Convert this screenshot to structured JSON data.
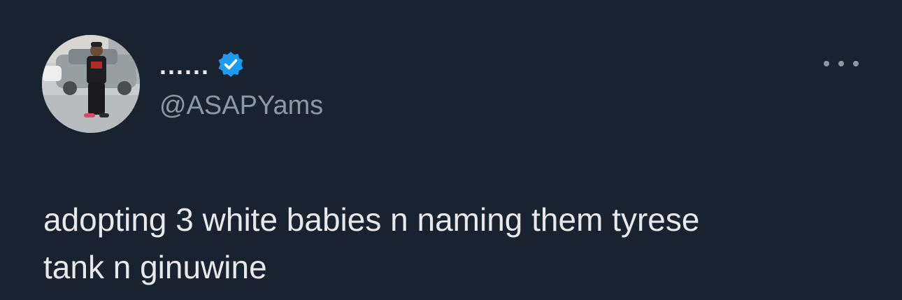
{
  "tweet": {
    "author": {
      "display_name": "......",
      "handle": "@ASAPYams",
      "verified": true,
      "verified_icon": "verified-badge-icon",
      "avatar": "avatar-photo"
    },
    "more_icon": "more-horizontal-icon",
    "text_lines": [
      "adopting 3 white babies n naming them tyrese",
      "tank n ginuwine"
    ]
  },
  "colors": {
    "background": "#192330",
    "text": "#e7e9ea",
    "secondary_text": "#8b98a5",
    "verified_blue": "#1d9bf0"
  }
}
